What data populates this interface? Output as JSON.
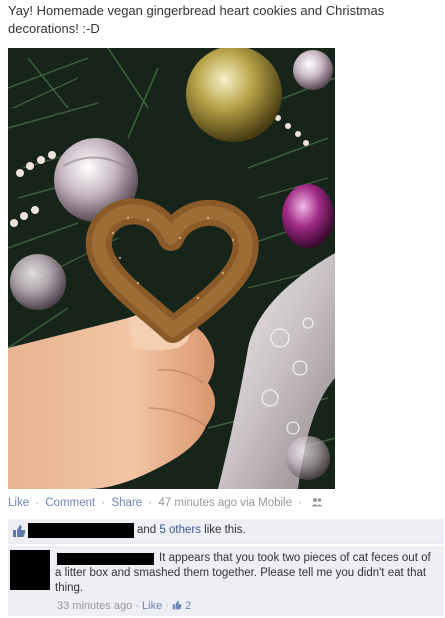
{
  "post": {
    "text": "Yay! Homemade vegan gingerbread heart cookies and Christmas decorations! :-D"
  },
  "photo": {
    "description_icon": "photo-christmas-tree-cookie"
  },
  "actions": {
    "like": "Like",
    "comment": "Comment",
    "share": "Share",
    "timestamp": "47 minutes ago via Mobile",
    "separator": "·",
    "audience_icon": "friends-icon"
  },
  "likes": {
    "text_prefix": "and",
    "others_link": "5 others",
    "text_suffix": "like this.",
    "icon": "thumbs-up-icon"
  },
  "comment": {
    "text": "It appears that you took two pieces of cat feces out of a litter box and smashed them together. Please tell me you didn't eat that thing.",
    "timestamp": "33 minutes ago",
    "like_label": "Like",
    "like_count": "2"
  },
  "colors": {
    "link": "#6d84b4",
    "ufi_background": "#edeff4"
  }
}
